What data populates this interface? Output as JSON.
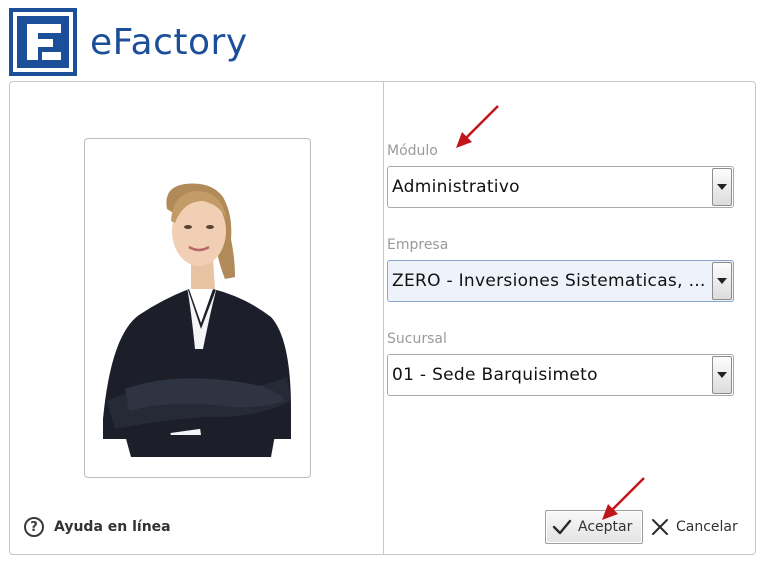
{
  "app": {
    "title": "eFactory",
    "brand_color": "#1b4f99"
  },
  "form": {
    "modulo": {
      "label": "Módulo",
      "value": "Administrativo"
    },
    "empresa": {
      "label": "Empresa",
      "value": "ZERO - Inversiones Sistematicas, C.A."
    },
    "sucursal": {
      "label": "Sucursal",
      "value": "01 - Sede Barquisimeto"
    }
  },
  "help": {
    "label": "Ayuda en línea",
    "icon": "question-circle-icon"
  },
  "buttons": {
    "accept": {
      "label": "Aceptar",
      "icon": "checkmark-icon"
    },
    "cancel": {
      "label": "Cancelar",
      "icon": "close-icon"
    }
  },
  "annotations": {
    "arrow_color": "#c0151a"
  }
}
